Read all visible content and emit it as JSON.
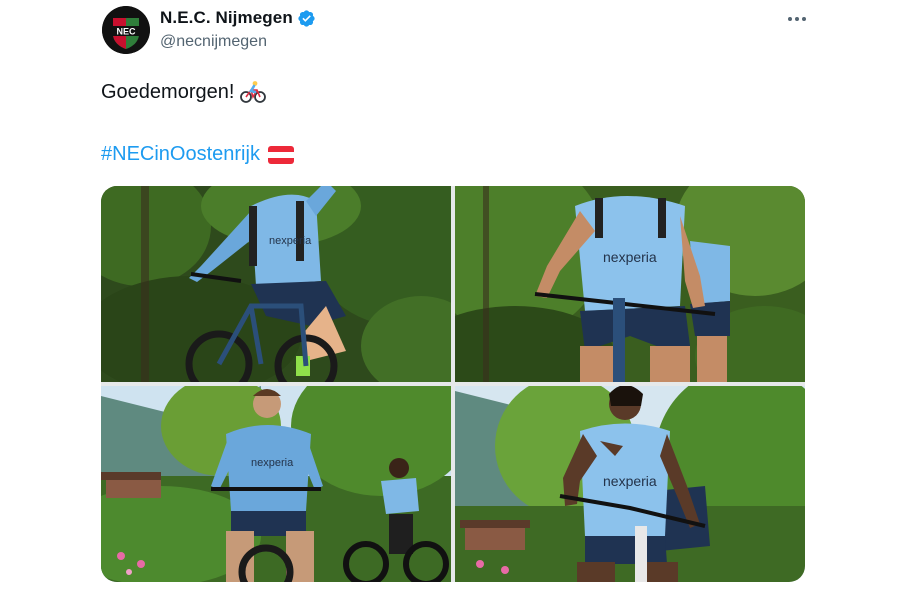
{
  "author": {
    "display_name": "N.E.C. Nijmegen",
    "handle": "@necnijmegen",
    "avatar_icon": "nec-club-crest-icon",
    "avatar_text": "NEC",
    "verified_icon": "verified-badge-icon"
  },
  "menu": {
    "icon": "more-options-icon"
  },
  "tweet": {
    "text": "Goedemorgen!",
    "emoji_icon": "cyclist-emoji-icon",
    "hashtag": "#NECinOostenrijk",
    "flag_icon": "austria-flag-icon"
  },
  "colors": {
    "link": "#1d9bf0",
    "verified": "#1d9bf0",
    "secondary_text": "#536471",
    "primary_text": "#0f1419"
  },
  "jersey_sponsor": "nexperia",
  "media": [
    {
      "id": "photo-1",
      "alt": "player cycling, arm raised"
    },
    {
      "id": "photo-2",
      "alt": "player cycling toward camera"
    },
    {
      "id": "photo-3",
      "alt": "two players cycling"
    },
    {
      "id": "photo-4",
      "alt": "player cycling with hand gesture"
    }
  ]
}
